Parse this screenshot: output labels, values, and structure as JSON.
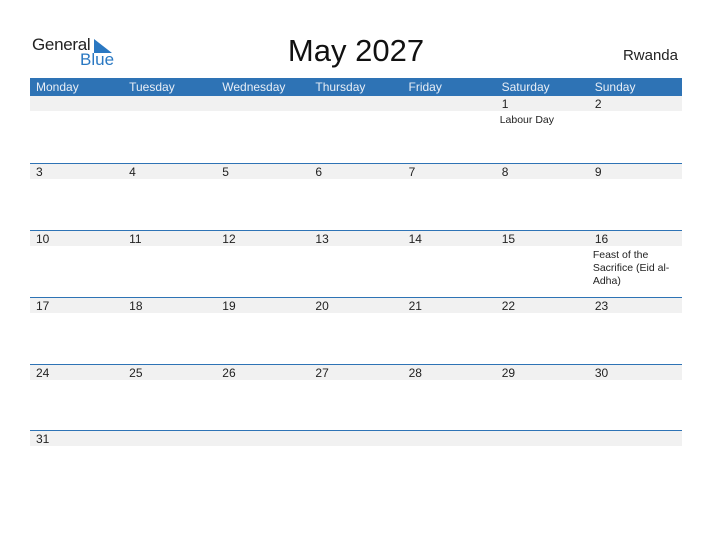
{
  "logo": {
    "general": "General",
    "blue": "Blue"
  },
  "title": "May 2027",
  "country": "Rwanda",
  "colors": {
    "header_bg": "#2e73b5",
    "accent": "#2a78c2"
  },
  "weekdays": [
    "Monday",
    "Tuesday",
    "Wednesday",
    "Thursday",
    "Friday",
    "Saturday",
    "Sunday"
  ],
  "weeks": [
    [
      {
        "day": ""
      },
      {
        "day": ""
      },
      {
        "day": ""
      },
      {
        "day": ""
      },
      {
        "day": ""
      },
      {
        "day": "1",
        "event": "Labour Day"
      },
      {
        "day": "2"
      }
    ],
    [
      {
        "day": "3"
      },
      {
        "day": "4"
      },
      {
        "day": "5"
      },
      {
        "day": "6"
      },
      {
        "day": "7"
      },
      {
        "day": "8"
      },
      {
        "day": "9"
      }
    ],
    [
      {
        "day": "10"
      },
      {
        "day": "11"
      },
      {
        "day": "12"
      },
      {
        "day": "13"
      },
      {
        "day": "14"
      },
      {
        "day": "15"
      },
      {
        "day": "16",
        "event": "Feast of the Sacrifice (Eid al-Adha)"
      }
    ],
    [
      {
        "day": "17"
      },
      {
        "day": "18"
      },
      {
        "day": "19"
      },
      {
        "day": "20"
      },
      {
        "day": "21"
      },
      {
        "day": "22"
      },
      {
        "day": "23"
      }
    ],
    [
      {
        "day": "24"
      },
      {
        "day": "25"
      },
      {
        "day": "26"
      },
      {
        "day": "27"
      },
      {
        "day": "28"
      },
      {
        "day": "29"
      },
      {
        "day": "30"
      }
    ],
    [
      {
        "day": "31"
      },
      {
        "day": ""
      },
      {
        "day": ""
      },
      {
        "day": ""
      },
      {
        "day": ""
      },
      {
        "day": ""
      },
      {
        "day": ""
      }
    ]
  ]
}
